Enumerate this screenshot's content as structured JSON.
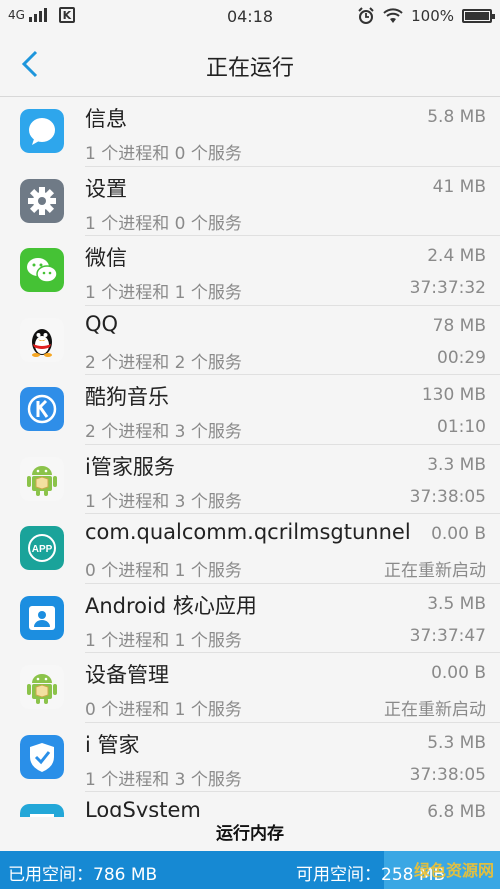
{
  "status_bar": {
    "network": "4G",
    "time": "04:18",
    "battery": "100%",
    "carrier_icon_letter": "K"
  },
  "header": {
    "title": "正在运行",
    "back_icon": "chevron-left-icon"
  },
  "apps": [
    {
      "name": "信息",
      "desc": "1 个进程和 0 个服务",
      "size": "5.8 MB",
      "status": "",
      "icon": "message-icon"
    },
    {
      "name": "设置",
      "desc": "1 个进程和 0 个服务",
      "size": "41 MB",
      "status": "",
      "icon": "gear-icon"
    },
    {
      "name": "微信",
      "desc": "1 个进程和 1 个服务",
      "size": "2.4 MB",
      "status": "37:37:32",
      "icon": "wechat-icon"
    },
    {
      "name": "QQ",
      "desc": "2 个进程和 2 个服务",
      "size": "78 MB",
      "status": "00:29",
      "icon": "qq-penguin-icon"
    },
    {
      "name": "酷狗音乐",
      "desc": "2 个进程和 3 个服务",
      "size": "130 MB",
      "status": "01:10",
      "icon": "kugou-icon"
    },
    {
      "name": "i管家服务",
      "desc": "1 个进程和 3 个服务",
      "size": "3.3 MB",
      "status": "37:38:05",
      "icon": "android-icon"
    },
    {
      "name": "com.qualcomm.qcrilmsgtunnel",
      "desc": "0 个进程和 1 个服务",
      "size": "0.00 B",
      "status": "正在重新启动",
      "icon": "app-icon"
    },
    {
      "name": "Android 核心应用",
      "desc": "1 个进程和 1 个服务",
      "size": "3.5 MB",
      "status": "37:37:47",
      "icon": "user-icon"
    },
    {
      "name": "设备管理",
      "desc": "0 个进程和 1 个服务",
      "size": "0.00 B",
      "status": "正在重新启动",
      "icon": "android-icon"
    },
    {
      "name": "i 管家",
      "desc": "1 个进程和 3 个服务",
      "size": "5.3 MB",
      "status": "37:38:05",
      "icon": "shield-check-icon"
    },
    {
      "name": "LogSystem",
      "desc": "",
      "size": "6.8 MB",
      "status": "",
      "icon": "log-icon"
    }
  ],
  "footer": {
    "label": "运行内存",
    "used": "已用空间：786 MB",
    "free": "可用空间：258 MB",
    "watermark": "绿色资源网"
  },
  "colors": {
    "accent": "#1e96dc",
    "usage_used": "#1689d3",
    "usage_free": "#3aa7e4"
  }
}
